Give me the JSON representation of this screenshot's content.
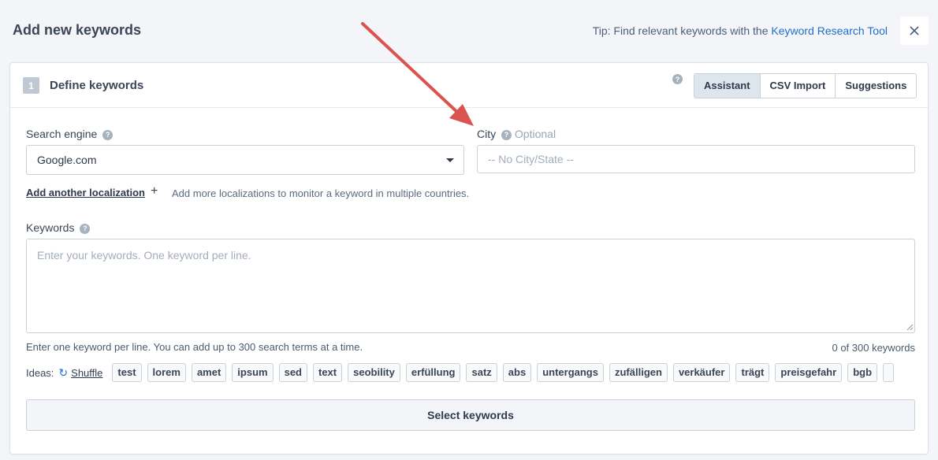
{
  "header": {
    "title": "Add new keywords",
    "tip_prefix": "Tip: Find relevant keywords with the ",
    "tip_link": "Keyword Research Tool",
    "close_icon": "close-icon"
  },
  "step": {
    "number": "1",
    "title": "Define keywords",
    "help": "?",
    "tabs": [
      {
        "label": "Assistant",
        "active": true
      },
      {
        "label": "CSV Import",
        "active": false
      },
      {
        "label": "Suggestions",
        "active": false
      }
    ]
  },
  "form": {
    "search_engine_label": "Search engine",
    "search_engine_value": "Google.com",
    "city_label": "City",
    "city_optional": "Optional",
    "city_placeholder": "-- No City/State --",
    "add_localization": "Add another localization",
    "add_plus": "+",
    "add_localization_hint": "Add more localizations to monitor a keyword in multiple countries.",
    "keywords_label": "Keywords",
    "keywords_placeholder": "Enter your keywords. One keyword per line.",
    "keywords_hint": "Enter one keyword per line. You can add up to 300 search terms at a time.",
    "keywords_count": "0 of 300 keywords"
  },
  "ideas": {
    "label": "Ideas:",
    "shuffle": "Shuffle",
    "chips": [
      "test",
      "lorem",
      "amet",
      "ipsum",
      "sed",
      "text",
      "seobility",
      "erfüllung",
      "satz",
      "abs",
      "untergangs",
      "zufälligen",
      "verkäufer",
      "trägt",
      "preisgefahr",
      "bgb",
      ""
    ]
  },
  "select_button": "Select keywords",
  "colors": {
    "accent": "#1f6fc7",
    "annotation_arrow": "#d9534f"
  }
}
